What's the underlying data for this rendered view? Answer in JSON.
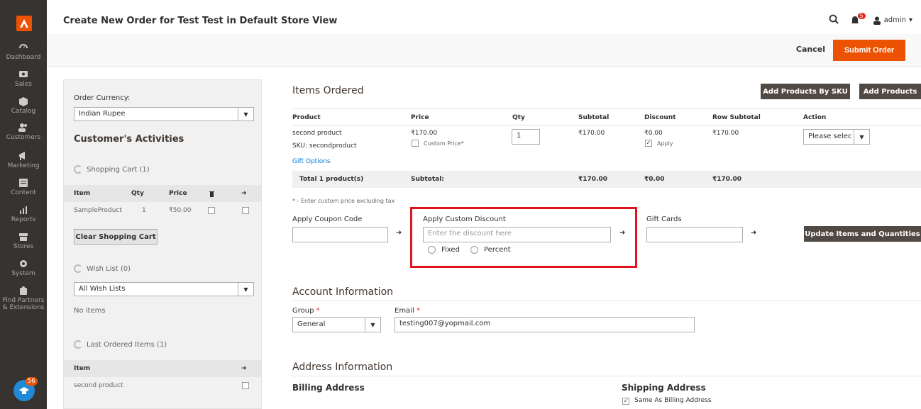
{
  "header": {
    "title": "Create New Order for Test Test in Default Store View",
    "notification_count": "5",
    "user": "admin"
  },
  "sidebar": {
    "items": [
      {
        "label": "Dashboard"
      },
      {
        "label": "Sales"
      },
      {
        "label": "Catalog"
      },
      {
        "label": "Customers"
      },
      {
        "label": "Marketing"
      },
      {
        "label": "Content"
      },
      {
        "label": "Reports"
      },
      {
        "label": "Stores"
      },
      {
        "label": "System"
      },
      {
        "label": "Find Partners & Extensions"
      }
    ],
    "help_badge_count": "56"
  },
  "actions": {
    "cancel": "Cancel",
    "submit": "Submit Order"
  },
  "left_panel": {
    "currency_label": "Order Currency:",
    "currency_value": "Indian Rupee",
    "activities_heading": "Customer's Activities",
    "shopping_cart": {
      "title": "Shopping Cart (1)",
      "headers": [
        "Item",
        "Qty",
        "Price"
      ],
      "rows": [
        {
          "item": "SampleProduct",
          "qty": "1",
          "price": "₹50.00"
        }
      ],
      "clear_button": "Clear Shopping Cart"
    },
    "wish_list": {
      "title": "Wish List (0)",
      "select_value": "All Wish Lists",
      "empty": "No items"
    },
    "last_ordered": {
      "title": "Last Ordered Items (1)",
      "header": "Item",
      "rows": [
        {
          "item": "second product"
        }
      ]
    }
  },
  "items_ordered": {
    "title": "Items Ordered",
    "add_by_sku": "Add Products By SKU",
    "add_products": "Add Products",
    "headers": {
      "product": "Product",
      "price": "Price",
      "qty": "Qty",
      "subtotal": "Subtotal",
      "discount": "Discount",
      "row_subtotal": "Row Subtotal",
      "action": "Action"
    },
    "row": {
      "name": "second product",
      "sku": "SKU: secondproduct",
      "price": "₹170.00",
      "custom_price": "Custom Price*",
      "qty": "1",
      "subtotal": "₹170.00",
      "discount": "₹0.00",
      "apply": "Apply",
      "row_subtotal": "₹170.00",
      "action_value": "Please selec"
    },
    "gift_options": "Gift Options",
    "totals": {
      "label": "Total 1 product(s)",
      "subtotal_label": "Subtotal:",
      "subtotal": "₹170.00",
      "discount": "₹0.00",
      "row_subtotal": "₹170.00"
    },
    "note": "* - Enter custom price excluding tax"
  },
  "coupon": {
    "label": "Apply Coupon Code",
    "value": ""
  },
  "custom_discount": {
    "label": "Apply Custom Discount",
    "placeholder": "Enter the discount here",
    "fixed": "Fixed",
    "percent": "Percent"
  },
  "gift_cards": {
    "label": "Gift Cards",
    "value": ""
  },
  "update_button": "Update Items and Quantities",
  "account": {
    "title": "Account Information",
    "group_label": "Group",
    "group_value": "General",
    "email_label": "Email",
    "email_value": "testing007@yopmail.com"
  },
  "address": {
    "title": "Address Information",
    "billing": "Billing Address",
    "shipping": "Shipping Address",
    "same_as_billing": "Same As Billing Address"
  },
  "colors": {
    "accent": "#eb5202",
    "sidebar": "#373330",
    "highlight": "#e0141e",
    "link": "#007bdb"
  }
}
